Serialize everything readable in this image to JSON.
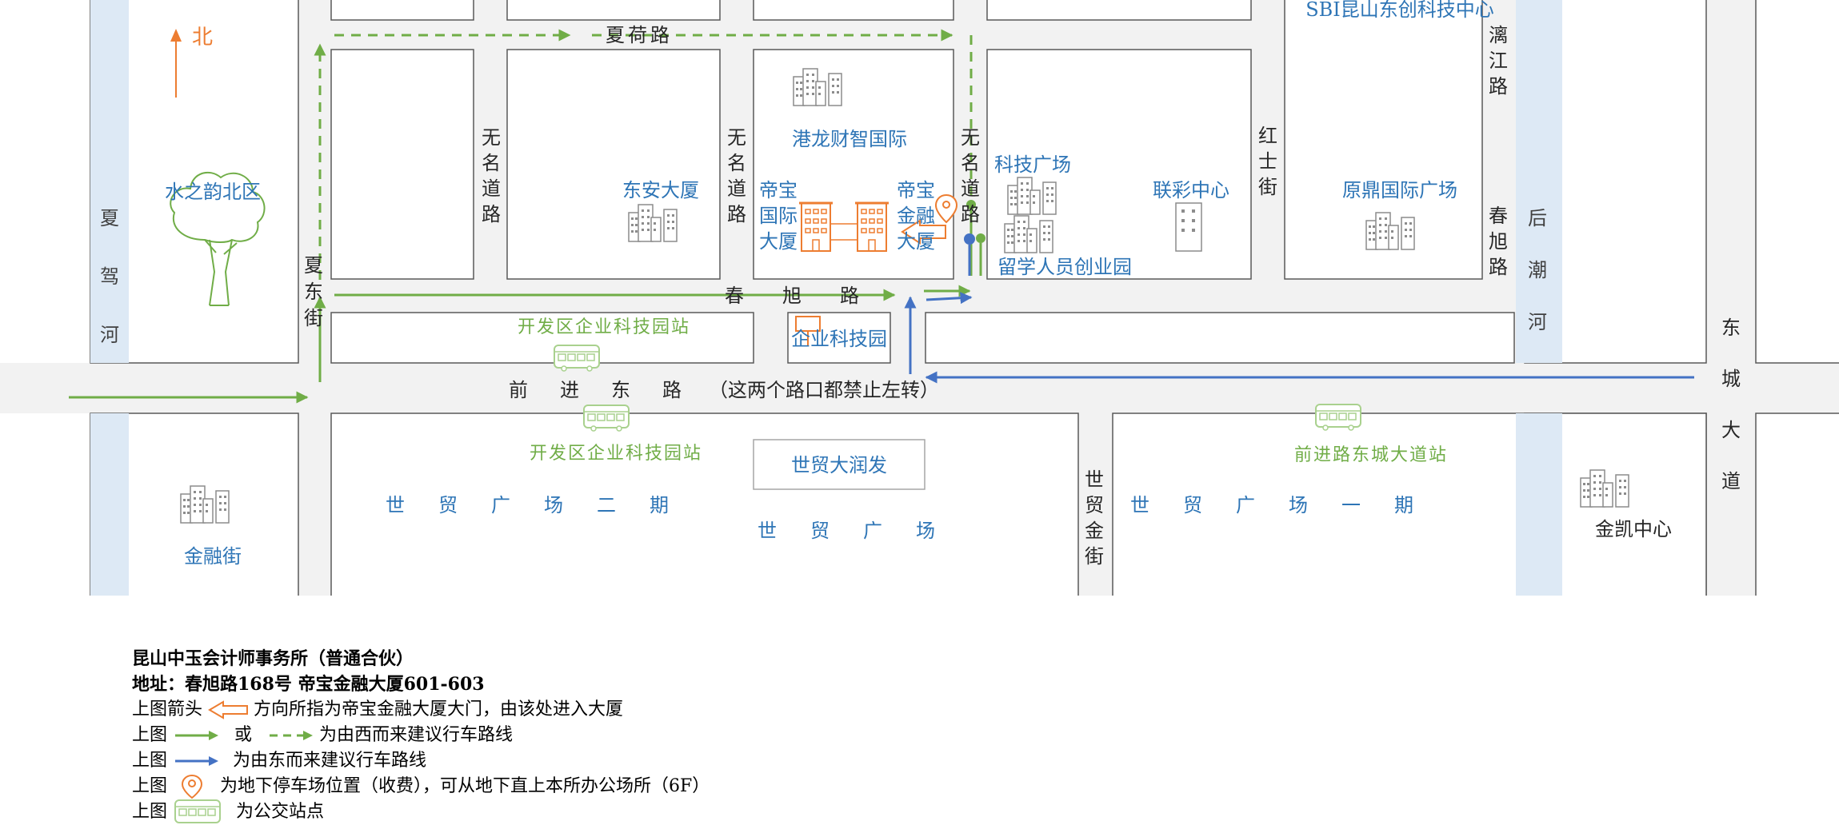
{
  "colors": {
    "road": "#f2f2f2",
    "block_border": "#595959",
    "river": "#dde9f5",
    "green": "#70ad47",
    "blue": "#4472c4",
    "orange": "#ed7d31",
    "bus_green": "#a9d18e",
    "label_blue": "#2e75b6",
    "station_green": "#70ad47",
    "icon_gray": "#7f7f7f"
  },
  "map": {
    "north": "北",
    "rivers": {
      "west": "夏驾河",
      "east": "后潮河"
    },
    "roads": {
      "xiahe": "夏荷路",
      "xiadong": "夏东街",
      "wuming_1": "无名道路",
      "wuming_2": "无名道路",
      "wuming_3": "无名道路",
      "chunxu": "春旭路",
      "qianjin_east": "前进东路",
      "qianjin_note": "（这两个路口都禁止左转）",
      "hongshi": "红士街",
      "chunxu_v": "春旭路",
      "lijiang": "漓江路",
      "dongcheng": "东城大道",
      "shimao_jin": "世贸金街"
    },
    "buildings": {
      "shuizhiyun": "水之韵北区",
      "dongan": "东安大厦",
      "ganglong": "港龙财智国际",
      "dibao_intl": "帝宝国际大厦",
      "dibao_fin": "帝宝金融大厦",
      "keji_guangchang": "科技广场",
      "liucai": "联彩中心",
      "liuxue": "留学人员创业园",
      "sbi": "SBI昆山东创科技中心",
      "yuanding": "原鼎国际广场",
      "qiye_keji": "企业科技园",
      "shimao_runfa": "世贸大润发",
      "shimao_2": "世贸广场二期",
      "shimao": "世贸广场",
      "shimao_1": "世贸广场一期",
      "jinrong_jie": "金融街",
      "jinkai": "金凯中心"
    },
    "stations": {
      "kaifa_north": "开发区企业科技园站",
      "kaifa_south": "开发区企业科技园站",
      "qianjin_dongcheng": "前进路东城大道站"
    }
  },
  "legend": {
    "firm": "昆山中玉会计师事务所（普通合伙）",
    "address": "地址：春旭路168号 帝宝金融大厦601-603",
    "line1_pre": "上图箭头",
    "line1_post": "方向所指为帝宝金融大厦大门，由该处进入大厦",
    "line2_pre": "上图",
    "line2_mid": "或",
    "line2_post": "为由西而来建议行车路线",
    "line3_pre": "上图",
    "line3_post": "为由东而来建议行车路线",
    "line4_pre": "上图",
    "line4_post": "为地下停车场位置（收费），可从地下直上本所办公场所（6F）",
    "line5_pre": "上图",
    "line5_post": "为公交站点"
  }
}
